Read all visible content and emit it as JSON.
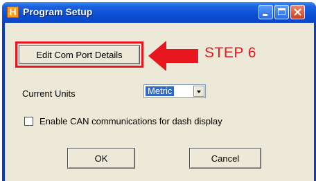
{
  "window": {
    "title": "Program Setup",
    "app_icon_letter": "H"
  },
  "controls": {
    "edit_com_port_label": "Edit Com Port Details",
    "current_units_label": "Current Units",
    "current_units_value": "Metric",
    "can_checkbox_label": "Enable CAN communications for dash display",
    "can_checkbox_checked": false,
    "ok_label": "OK",
    "cancel_label": "Cancel"
  },
  "annotation": {
    "step_label": "STEP 6",
    "color": "#e8161f"
  },
  "icons": [
    "app-icon",
    "minimize-icon",
    "maximize-icon",
    "close-icon",
    "chevron-down-icon",
    "arrow-left-icon"
  ]
}
